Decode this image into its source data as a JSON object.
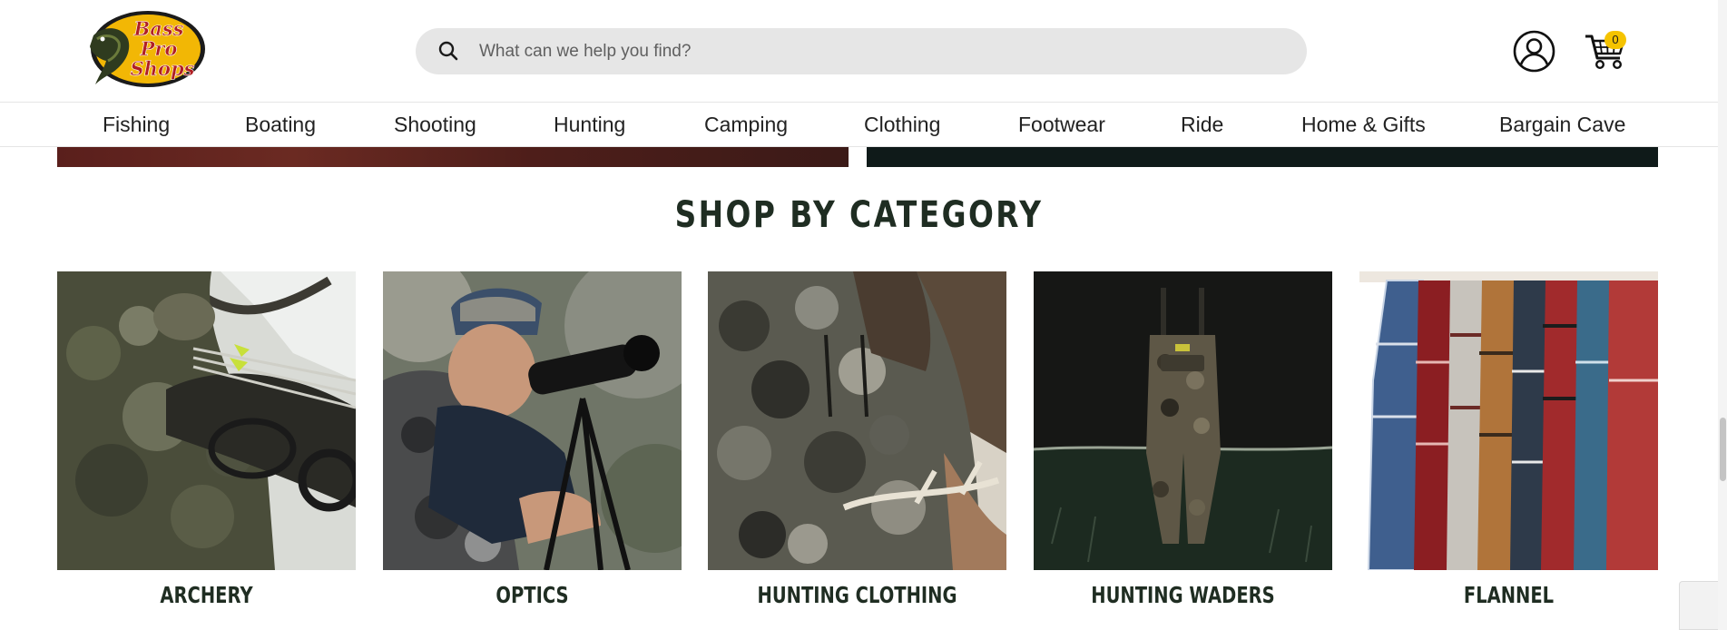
{
  "brand": {
    "logo_lines": [
      "Bass",
      "Pro",
      "Shops"
    ],
    "accent": "#f5c300"
  },
  "search": {
    "placeholder": "What can we help you find?",
    "value": ""
  },
  "account": {
    "icon": "user-circle-icon"
  },
  "cart": {
    "count": "0",
    "icon": "shopping-cart-icon"
  },
  "nav": {
    "items": [
      "Fishing",
      "Boating",
      "Shooting",
      "Hunting",
      "Camping",
      "Clothing",
      "Footwear",
      "Ride",
      "Home & Gifts",
      "Bargain Cave"
    ]
  },
  "section": {
    "title": "SHOP BY CATEGORY"
  },
  "categories": [
    {
      "label": "ARCHERY",
      "image": "archery-camo-hunter-with-bow"
    },
    {
      "label": "OPTICS",
      "image": "hunter-using-spotting-scope"
    },
    {
      "label": "HUNTING CLOTHING",
      "image": "camo-hunting-jacket-with-antlers"
    },
    {
      "label": "HUNTING WADERS",
      "image": "camo-chest-waders-in-water"
    },
    {
      "label": "FLANNEL",
      "image": "rack-of-flannel-shirts"
    }
  ],
  "colors": {
    "heading": "#1f2d22",
    "search_bg": "#e6e6e6",
    "cart_badge": "#f5c300"
  }
}
